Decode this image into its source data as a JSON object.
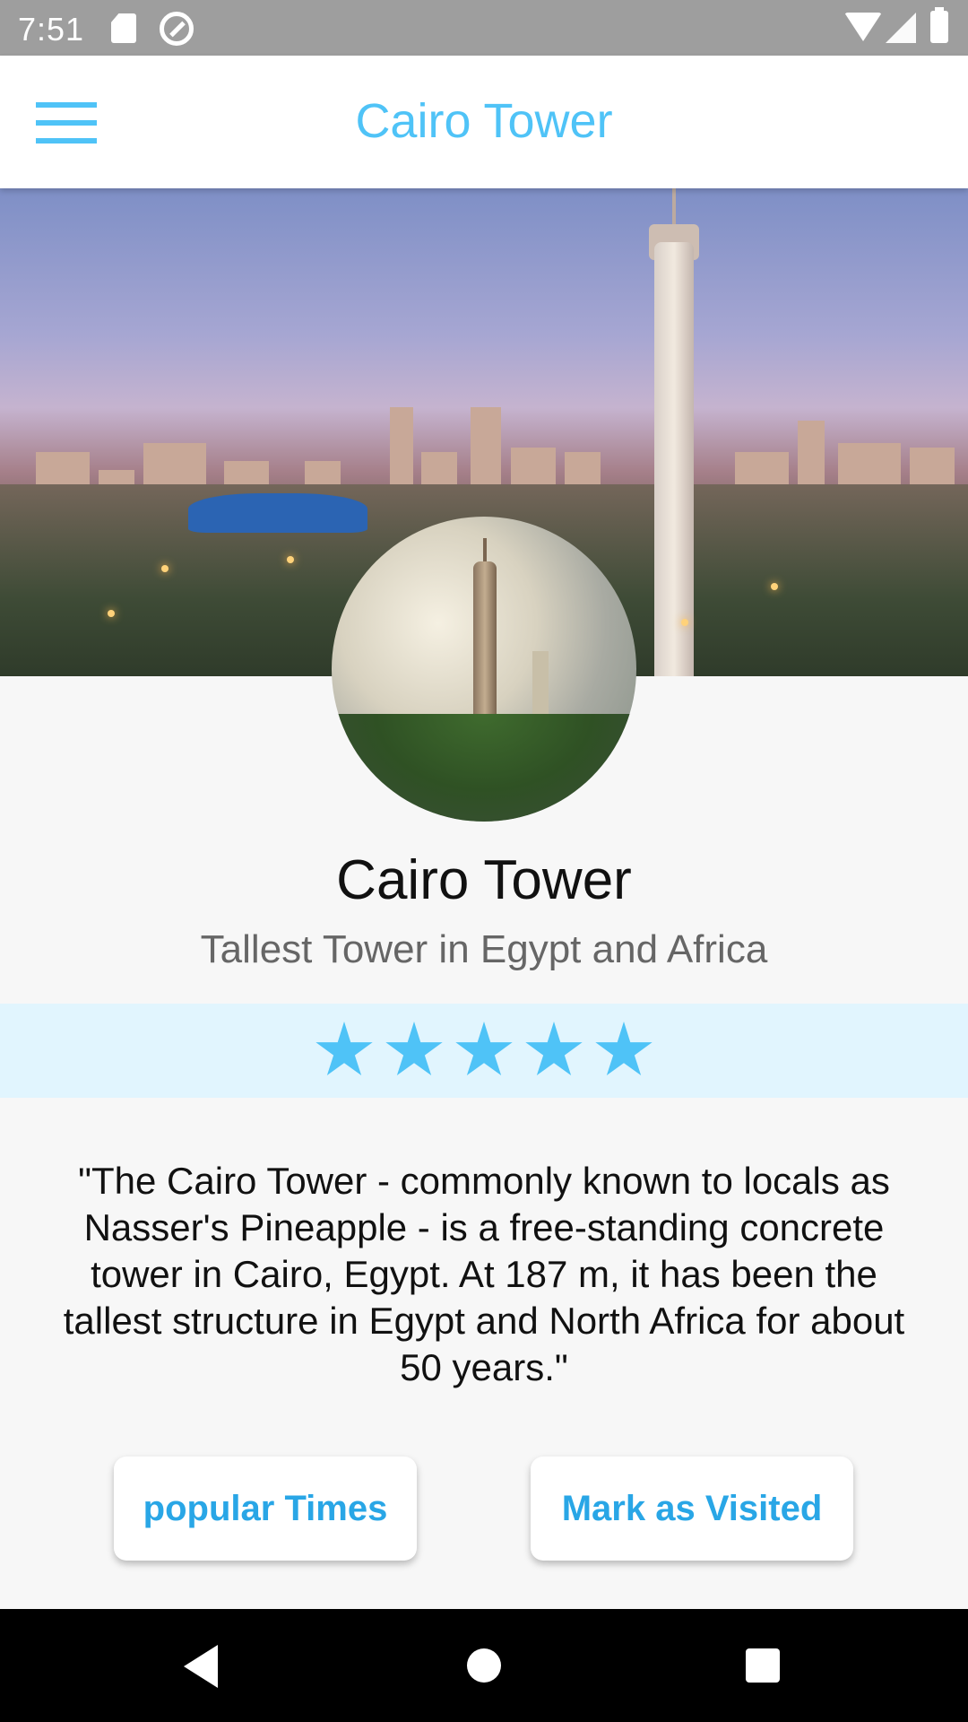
{
  "status_bar": {
    "time": "7:51",
    "icons": [
      "sd-card-icon",
      "sync-icon",
      "wifi-icon",
      "signal-icon",
      "battery-icon"
    ]
  },
  "app_bar": {
    "title": "Cairo Tower",
    "menu_icon": "menu-icon"
  },
  "place": {
    "name": "Cairo Tower",
    "subtitle": "Tallest Tower in Egypt and Africa",
    "rating": 5,
    "rating_max": 5,
    "description": "\"The Cairo Tower - commonly known to locals as Nasser's Pineapple - is a free-standing concrete tower in Cairo, Egypt. At 187 m, it has been the tallest structure in Egypt and North Africa for about 50 years.\""
  },
  "actions": {
    "popular_times_label": "popular Times",
    "mark_visited_label": "Mark as Visited"
  },
  "nav_bar": {
    "icons": [
      "back-icon",
      "home-icon",
      "recents-icon"
    ]
  },
  "colors": {
    "accent": "#4fc3f7",
    "button_text": "#29a6e6",
    "rating_band": "#e1f5fe",
    "status_bar": "#9e9e9e"
  }
}
